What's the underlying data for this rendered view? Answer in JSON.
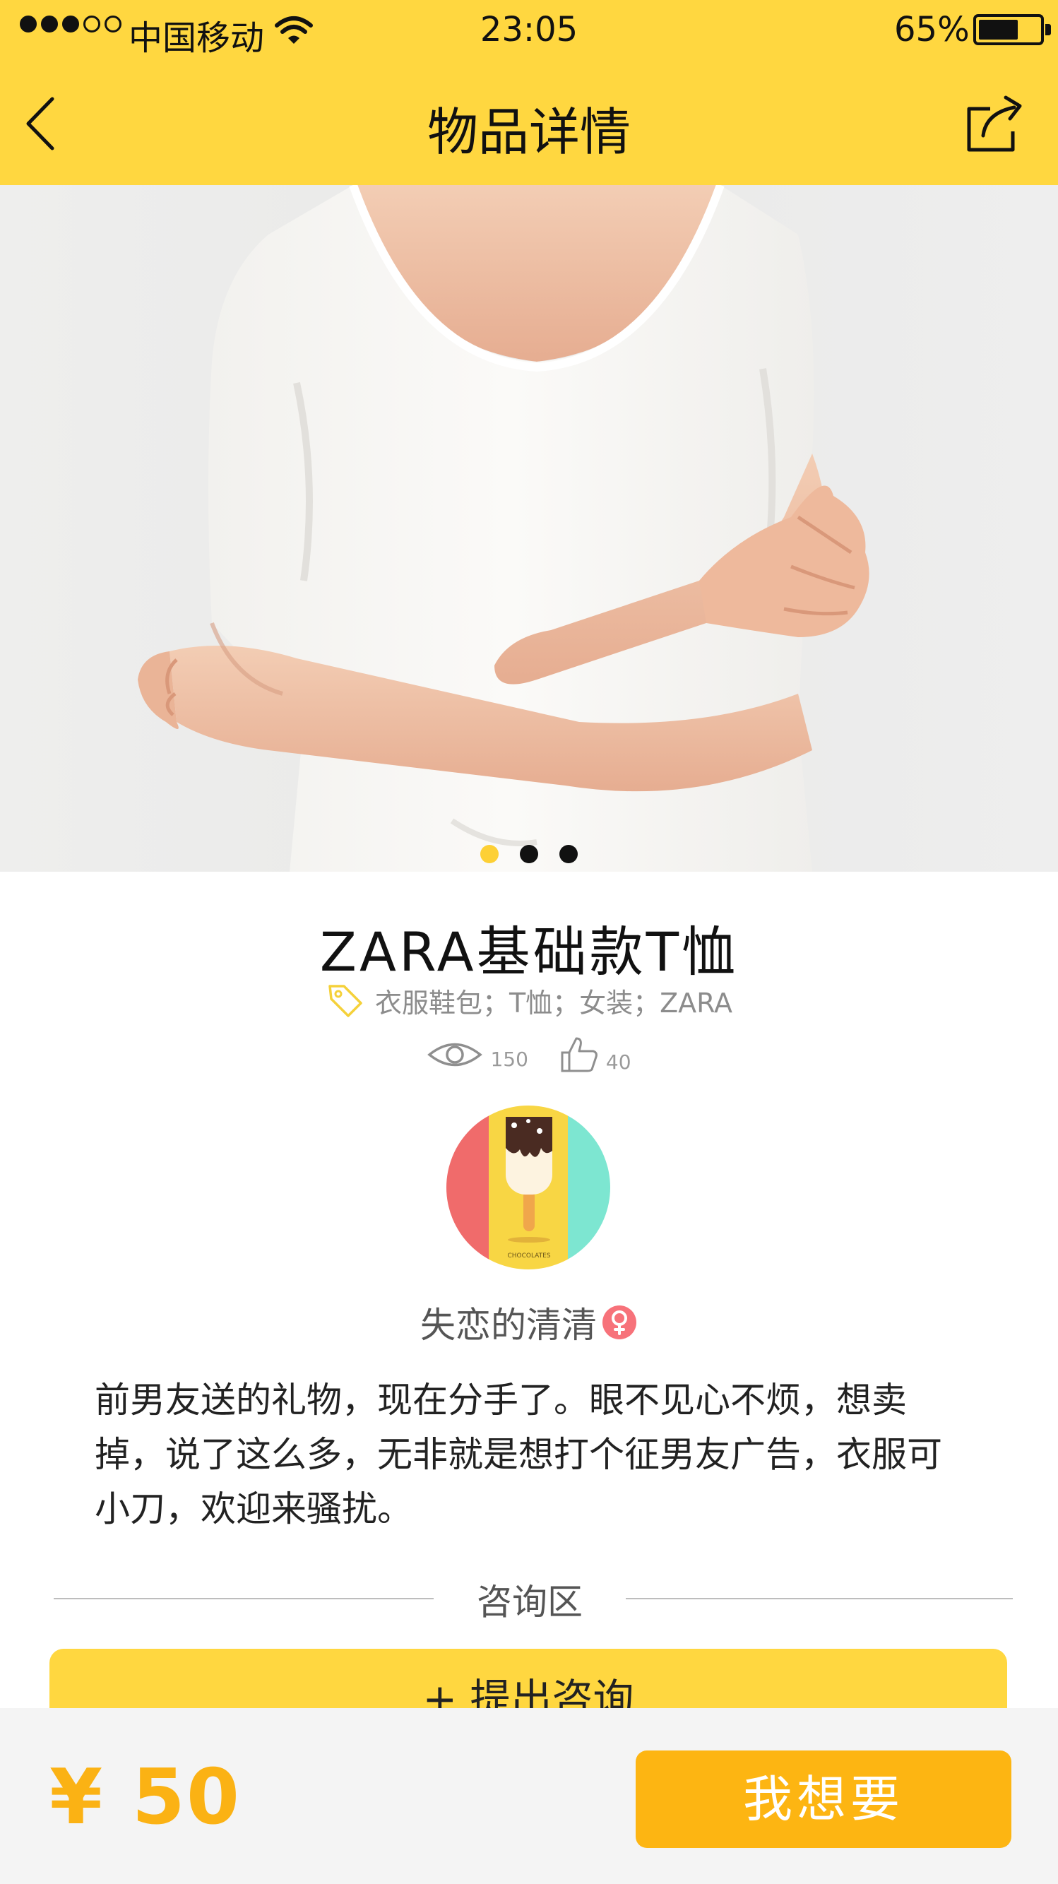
{
  "status_bar": {
    "carrier": "中国移动",
    "time": "23:05",
    "battery_percent_text": "65%",
    "battery_level": 0.65
  },
  "nav": {
    "title": "物品详情",
    "back_icon": "chevron-left-icon",
    "share_icon": "share-icon"
  },
  "gallery": {
    "image_count": 3,
    "active_index": 0,
    "active_color": "#fdd035"
  },
  "item": {
    "title": "ZARA基础款T恤",
    "tags": "衣服鞋包；T恤；女装；ZARA",
    "views": "150",
    "likes": "40"
  },
  "seller": {
    "name": "失恋的清清",
    "gender_icon": "female-icon",
    "avatar_caption": "CHOCOLATES"
  },
  "description": "前男友送的礼物，现在分手了。眼不见心不烦，想卖掉，说了这么多，无非就是想打个征男友广告，衣服可小刀，欢迎来骚扰。",
  "consult": {
    "section_label": "咨询区",
    "ask_button": "+ 提出咨询"
  },
  "purchase": {
    "price": "¥ 50",
    "want_button": "我想要"
  },
  "colors": {
    "header": "#ffd740",
    "accent": "#fdb512",
    "price": "#fbb214"
  }
}
